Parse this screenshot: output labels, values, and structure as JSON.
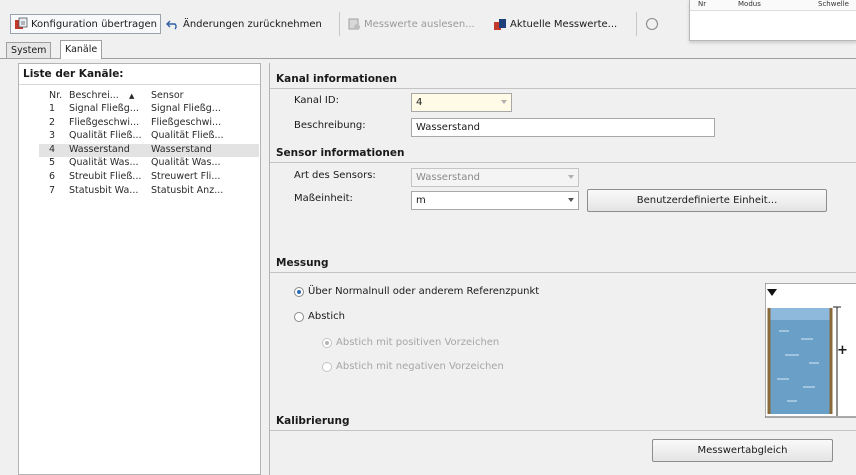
{
  "toolbar": {
    "transfer_label": "Konfiguration übertragen",
    "undo_label": "Änderungen zurücknehmen",
    "read_label": "Messwerte auslesen...",
    "current_label": "Aktuelle Messwerte...",
    "colors": {
      "transfer_icon": "#c0392b",
      "read_icon_disabled": "#9a9a9a",
      "current_icon": "#c0392b"
    }
  },
  "mini_window": {
    "columns": [
      "Nr",
      "Modus",
      "Schwelle"
    ]
  },
  "tabs": [
    {
      "label": "System",
      "active": false
    },
    {
      "label": "Kanäle",
      "active": true
    }
  ],
  "channel_list": {
    "title": "Liste der Kanäle:",
    "columns": {
      "nr": "Nr.",
      "description": "Beschrei...",
      "sort_indicator": "▲",
      "sensor": "Sensor"
    },
    "rows": [
      {
        "nr": "1",
        "description": "Signal Fließg...",
        "sensor": "Signal Fließg..."
      },
      {
        "nr": "2",
        "description": "Fließgeschwi...",
        "sensor": "Fließgeschwi..."
      },
      {
        "nr": "3",
        "description": "Qualität Fließ...",
        "sensor": "Qualität Fließ..."
      },
      {
        "nr": "4",
        "description": "Wasserstand",
        "sensor": "Wasserstand",
        "selected": true
      },
      {
        "nr": "5",
        "description": "Qualität Was...",
        "sensor": "Qualität Was..."
      },
      {
        "nr": "6",
        "description": "Streubit Fließ...",
        "sensor": "Streuwert Fli..."
      },
      {
        "nr": "7",
        "description": "Statusbit Wa...",
        "sensor": "Statusbit Anz..."
      }
    ]
  },
  "kanal": {
    "section": "Kanal informationen",
    "id_label": "Kanal ID:",
    "id_value": "4",
    "desc_label": "Beschreibung:",
    "desc_value": "Wasserstand"
  },
  "sensor": {
    "section": "Sensor informationen",
    "type_label": "Art des Sensors:",
    "type_value": "Wasserstand",
    "unit_label": "Maßeinheit:",
    "unit_value": "m",
    "custom_unit_button": "Benutzerdefinierte Einheit..."
  },
  "messung": {
    "section": "Messung",
    "option_nn": "Über Normalnull oder anderem Referenzpunkt",
    "option_abstich": "Abstich",
    "sub_positive": "Abstich mit positiven Vorzeichen",
    "sub_negative": "Abstich mit negativen Vorzeichen",
    "selected": "option_nn",
    "illustration_plus": "+"
  },
  "kalibrierung": {
    "section": "Kalibrierung",
    "button": "Messwertabgleich"
  }
}
